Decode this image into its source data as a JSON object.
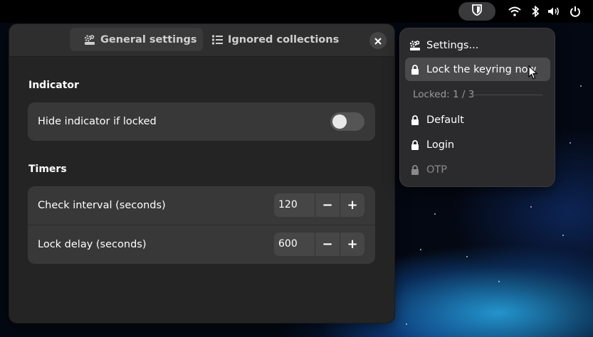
{
  "topbar": {
    "extension_icon": "bitwarden-shield-icon",
    "tray": [
      "wifi-icon",
      "bluetooth-icon",
      "volume-icon",
      "power-icon"
    ]
  },
  "window": {
    "tabs": [
      {
        "label": "General settings",
        "icon": "settings-icon",
        "active": true
      },
      {
        "label": "Ignored collections",
        "icon": "list-icon",
        "active": false
      }
    ],
    "close_icon": "close-icon",
    "indicator": {
      "title": "Indicator",
      "rows": [
        {
          "label": "Hide indicator if locked",
          "switch_on": false
        }
      ]
    },
    "timers": {
      "title": "Timers",
      "rows": [
        {
          "label": "Check interval (seconds)",
          "value": "120",
          "minus": "−",
          "plus": "+"
        },
        {
          "label": "Lock delay (seconds)",
          "value": "600",
          "minus": "−",
          "plus": "+"
        }
      ]
    }
  },
  "menu": {
    "items": [
      {
        "label": "Settings...",
        "icon": "settings-icon"
      },
      {
        "label": "Lock the keyring now",
        "icon": "lock-icon"
      }
    ],
    "separator_label": "Locked: 1 / 3",
    "keyrings": [
      {
        "label": "Default",
        "icon": "lock-icon",
        "enabled": true
      },
      {
        "label": "Login",
        "icon": "lock-icon",
        "enabled": true
      },
      {
        "label": "OTP",
        "icon": "lock-icon",
        "enabled": false
      }
    ]
  },
  "colors": {
    "window_bg": "#242424",
    "card_bg": "#383838",
    "menu_bg": "#2b2b2d",
    "hover_bg": "#4a4a4c",
    "disabled_text": "#8a8a8a"
  }
}
